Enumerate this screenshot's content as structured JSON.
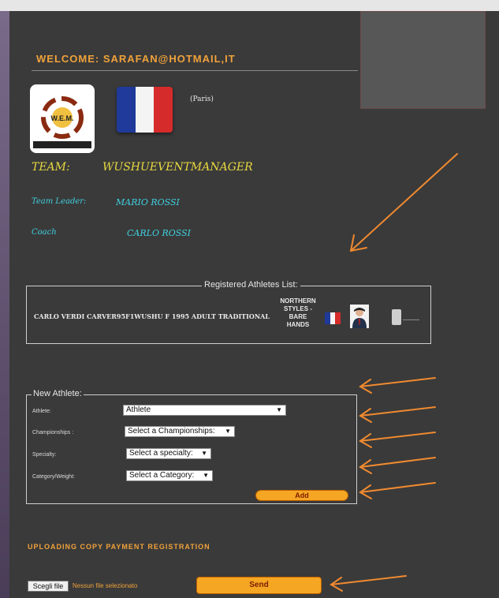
{
  "header": {
    "welcome": "WELCOME:   SARAFAN@HOTMAIL,IT"
  },
  "team": {
    "city": "(Paris)",
    "team_label": "TEAM:",
    "team_name": "WUSHUEVENTMANAGER",
    "leader_label": "Team Leader:",
    "leader_name": "MARIO ROSSI",
    "coach_label": "Coach",
    "coach_name": "CARLO ROSSI",
    "logo_text": "W.E.M."
  },
  "athletes": {
    "legend": "Registered Athletes List:",
    "row_text": "CARLO VERDI CARVER95F1WUSHU F 1995 ADULT TRADITIONAL",
    "style_line1": "NORTHERN",
    "style_line2": "STYLES -",
    "style_line3": "BARE",
    "style_line4": "HANDS",
    "trash_suffix": "-------"
  },
  "new_athlete": {
    "legend": "New Athlete:",
    "athlete_label": "Athlete:",
    "athlete_value": "Athlete",
    "championships_label": "Championships :",
    "championships_value": "Select a Championships:",
    "specialty_label": "Specialty:",
    "specialty_value": "Select a specialty:",
    "category_label": "Category/Weight:",
    "category_value": "Select a Category:",
    "add_label": "Add"
  },
  "upload": {
    "title": "UPLOADING COPY PAYMENT REGISTRATION",
    "file_button": "Scegli file",
    "file_status": "Nessun file selezionato",
    "send_label": "Send"
  },
  "colors": {
    "panel": "#3a3a3a",
    "accent_orange": "#f0a23a",
    "team_yellow": "#e8d840",
    "cyan": "#3fd0e0",
    "button": "#f5a623",
    "arrow": "#f08a30"
  },
  "icons": [
    "logo-icon",
    "france-flag-icon",
    "person-icon",
    "trash-icon",
    "chevron-down-icon",
    "arrow-annotation"
  ]
}
